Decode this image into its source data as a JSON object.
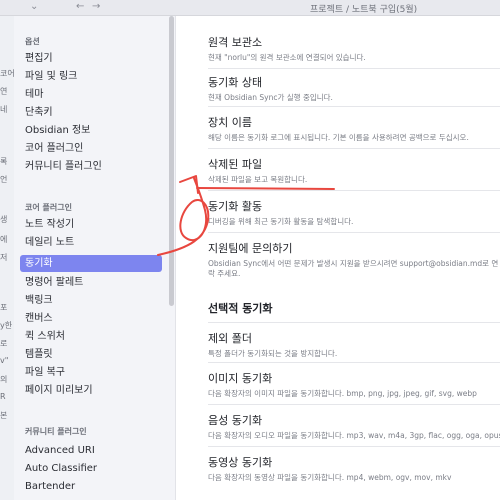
{
  "topbar": {
    "title": "프로젝트 / 노트북 구입(5월)",
    "chevron": "⌄",
    "back": "←",
    "forward": "→"
  },
  "background_strip": [
    "코어",
    "연",
    "네",
    "록",
    "언",
    "생",
    "에",
    "저",
    "포",
    "y한",
    "로",
    "v\"",
    "의",
    "R",
    "본"
  ],
  "sidebar": {
    "sections": [
      {
        "title": "옵션",
        "items": [
          "편집기",
          "파일 및 링크",
          "테마",
          "단축키",
          "Obsidian 정보",
          "코어 플러그인",
          "커뮤니티 플러그인"
        ]
      },
      {
        "title": "코어 플러그인",
        "items": [
          "노트 작성기",
          "데일리 노트",
          "동기화",
          "명령어 팔레트",
          "백링크",
          "캔버스",
          "퀵 스위처",
          "템플릿",
          "파일 복구",
          "페이지 미리보기"
        ]
      },
      {
        "title": "커뮤니티 플러그인",
        "items": [
          "Advanced URI",
          "Auto Classifier",
          "Bartender"
        ]
      }
    ],
    "active_item": "동기화"
  },
  "main": {
    "settings": [
      {
        "name": "원격 보관소",
        "desc": "현재 \"norlu\"의 원격 보관소에 연결되어 있습니다."
      },
      {
        "name": "동기화 상태",
        "desc": "현재 Obsidian Sync가 실행 중입니다."
      },
      {
        "name": "장치 이름",
        "desc": "해당 이름은 동기화 로그에 표시됩니다. 기본 이름을 사용하려면 공백으로 두십시오."
      },
      {
        "name": "삭제된 파일",
        "desc": "삭제된 파일을 보고 복원합니다."
      },
      {
        "name": "동기화 활동",
        "desc": "디버깅을 위해 최근 동기화 활동을 탐색합니다."
      },
      {
        "name": "지원팀에 문의하기",
        "desc": "Obsidian Sync에서 어떤 문제가 발생시 지원을 받으시려면 support@obsidian.md로 연락 주세요."
      }
    ],
    "selective_heading": "선택적 동기화",
    "selective": [
      {
        "name": "제외 폴더",
        "desc": "특정 폴더가 동기화되는 것을 방지합니다."
      },
      {
        "name": "이미지 동기화",
        "desc": "다음 확장자의 이미지 파일을 동기화합니다. bmp, png, jpg, jpeg, gif, svg, webp"
      },
      {
        "name": "음성 동기화",
        "desc": "다음 확장자의 오디오 파일을 동기화합니다. mp3, wav, m4a, 3gp, flac, ogg, oga, opus"
      },
      {
        "name": "동영상 동기화",
        "desc": "다음 확장자의 동영상 파일을 동기화합니다. mp4, webm, ogv, mov, mkv"
      }
    ]
  },
  "colors": {
    "accent": "#7d85ef",
    "annotation": "#e8473f"
  }
}
